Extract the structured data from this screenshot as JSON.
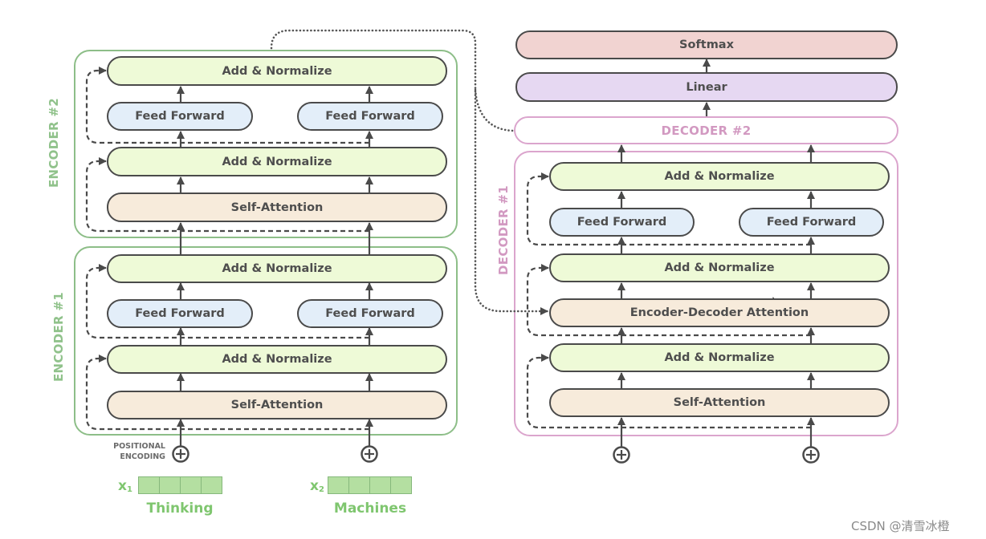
{
  "encoder_stack": {
    "encoder_2": {
      "label": "ENCODER #2",
      "add_normalize_top": "Add & Normalize",
      "feed_forward_left": "Feed Forward",
      "feed_forward_right": "Feed Forward",
      "add_normalize_bottom": "Add & Normalize",
      "self_attention": "Self-Attention"
    },
    "encoder_1": {
      "label": "ENCODER #1",
      "add_normalize_top": "Add & Normalize",
      "feed_forward_left": "Feed Forward",
      "feed_forward_right": "Feed Forward",
      "add_normalize_bottom": "Add & Normalize",
      "self_attention": "Self-Attention"
    }
  },
  "decoder_stack": {
    "softmax": "Softmax",
    "linear": "Linear",
    "decoder_2": {
      "label": "DECODER #2"
    },
    "decoder_1": {
      "label": "DECODER #1",
      "add_normalize_top": "Add & Normalize",
      "feed_forward_left": "Feed Forward",
      "feed_forward_right": "Feed Forward",
      "add_normalize_middle": "Add & Normalize",
      "encoder_decoder_attention": "Encoder-Decoder Attention",
      "add_normalize_bottom": "Add & Normalize",
      "self_attention": "Self-Attention"
    }
  },
  "inputs": {
    "positional_encoding_label": [
      "POSITIONAL",
      "ENCODING"
    ],
    "tokens": [
      {
        "symbol": "x",
        "subscript": "1",
        "word": "Thinking",
        "embedding_cells": 4
      },
      {
        "symbol": "x",
        "subscript": "2",
        "word": "Machines",
        "embedding_cells": 4
      }
    ]
  },
  "icons": {
    "sum": "circled-plus-icon",
    "flow": "arrow-up-icon",
    "residual": "dashed-arrow-icon",
    "encoder_output": "dotted-arrow-icon",
    "cursor": "mouse-pointer-icon"
  },
  "colors": {
    "encoder_border": "#8dbe88",
    "encoder_label": "#90c28b",
    "decoder_border": "#dba5cd",
    "decoder_label": "#d299c1",
    "add_normalize_fill": "#eefad7",
    "feed_forward_fill": "#e3eef9",
    "attention_fill": "#f7ebdb",
    "softmax_fill": "#f1d3d1",
    "linear_fill": "#e6d8f2",
    "token_text": "#7fc66f",
    "embedding_cell": "#b4dfa1",
    "embedding_cell_border": "#86b87c"
  },
  "watermark": "CSDN @清雪冰橙"
}
